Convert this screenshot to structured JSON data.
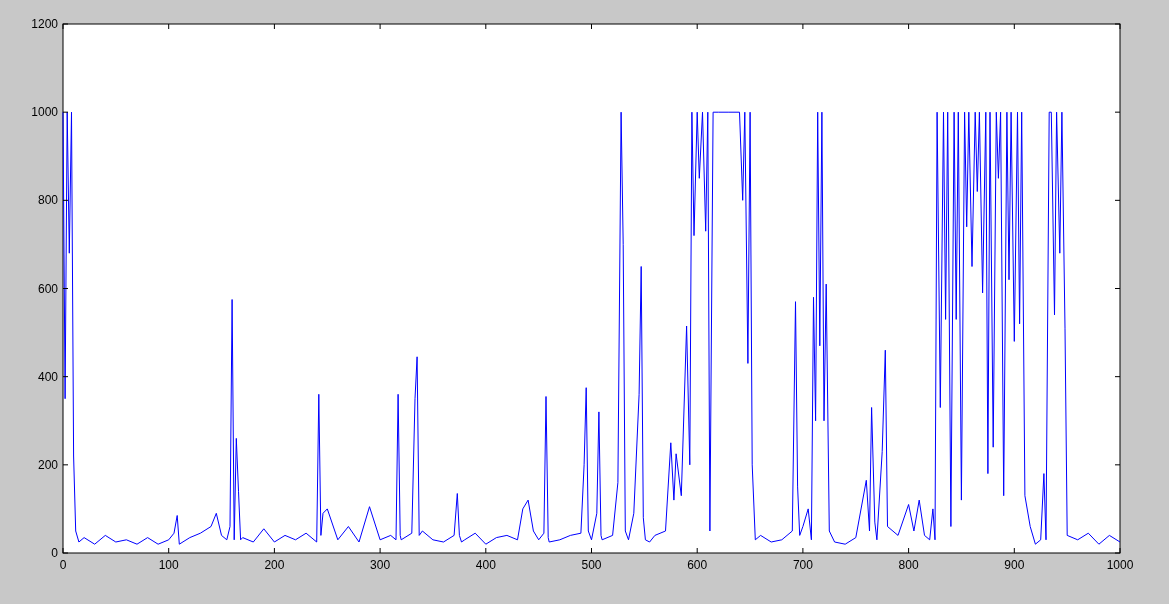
{
  "figure": {
    "chart_data": {
      "type": "line",
      "x": [
        0,
        2,
        4,
        6,
        8,
        10,
        12,
        15,
        20,
        30,
        40,
        50,
        60,
        70,
        80,
        90,
        100,
        105,
        108,
        110,
        120,
        130,
        140,
        145,
        150,
        155,
        158,
        160,
        162,
        164,
        166,
        168,
        170,
        180,
        190,
        200,
        210,
        220,
        230,
        240,
        242,
        244,
        246,
        250,
        260,
        270,
        280,
        290,
        300,
        310,
        315,
        317,
        319,
        320,
        330,
        333,
        335,
        337,
        340,
        350,
        360,
        370,
        373,
        375,
        377,
        380,
        390,
        400,
        410,
        420,
        430,
        435,
        440,
        445,
        450,
        455,
        457,
        459,
        460,
        470,
        480,
        490,
        493,
        495,
        497,
        500,
        505,
        507,
        509,
        510,
        520,
        525,
        528,
        530,
        532,
        535,
        540,
        545,
        547,
        549,
        551,
        555,
        560,
        570,
        575,
        578,
        580,
        585,
        590,
        593,
        595,
        597,
        600,
        602,
        605,
        608,
        610,
        612,
        615,
        620,
        630,
        640,
        643,
        645,
        648,
        650,
        652,
        655,
        660,
        670,
        680,
        690,
        693,
        695,
        697,
        700,
        705,
        708,
        710,
        712,
        714,
        716,
        718,
        720,
        722,
        725,
        730,
        740,
        750,
        760,
        763,
        765,
        768,
        770,
        775,
        778,
        780,
        790,
        800,
        805,
        810,
        815,
        820,
        823,
        825,
        827,
        830,
        833,
        835,
        837,
        840,
        843,
        845,
        847,
        850,
        853,
        855,
        857,
        860,
        863,
        865,
        867,
        870,
        873,
        875,
        877,
        880,
        883,
        885,
        887,
        890,
        893,
        895,
        897,
        900,
        903,
        905,
        907,
        910,
        915,
        920,
        925,
        928,
        930,
        933,
        935,
        938,
        940,
        943,
        945,
        948,
        950,
        960,
        970,
        980,
        990,
        1000
      ],
      "series": [
        {
          "color": "#0000ff",
          "values": [
            1000,
            350,
            1000,
            680,
            1000,
            220,
            50,
            25,
            35,
            20,
            40,
            25,
            30,
            20,
            35,
            20,
            30,
            45,
            85,
            20,
            35,
            45,
            60,
            90,
            40,
            30,
            60,
            575,
            30,
            260,
            140,
            30,
            35,
            25,
            55,
            25,
            40,
            30,
            45,
            25,
            360,
            40,
            90,
            100,
            30,
            60,
            25,
            105,
            30,
            40,
            30,
            360,
            40,
            30,
            45,
            350,
            445,
            40,
            50,
            30,
            25,
            40,
            135,
            40,
            25,
            30,
            45,
            20,
            35,
            40,
            30,
            100,
            120,
            50,
            30,
            45,
            355,
            35,
            25,
            30,
            40,
            45,
            200,
            375,
            50,
            30,
            90,
            320,
            40,
            30,
            40,
            160,
            1000,
            700,
            50,
            30,
            90,
            360,
            650,
            80,
            30,
            25,
            40,
            50,
            250,
            120,
            225,
            130,
            515,
            200,
            1000,
            720,
            1000,
            850,
            1000,
            730,
            1000,
            50,
            1000,
            1000,
            1000,
            1000,
            800,
            1000,
            430,
            1000,
            200,
            30,
            40,
            25,
            30,
            50,
            570,
            150,
            40,
            60,
            100,
            30,
            580,
            300,
            1000,
            470,
            1000,
            300,
            610,
            50,
            25,
            20,
            35,
            165,
            50,
            330,
            70,
            30,
            230,
            460,
            60,
            40,
            110,
            50,
            120,
            40,
            30,
            100,
            30,
            1000,
            330,
            1000,
            530,
            1000,
            60,
            1000,
            530,
            1000,
            120,
            1000,
            740,
            1000,
            650,
            1000,
            820,
            1000,
            590,
            1000,
            180,
            1000,
            240,
            1000,
            850,
            1000,
            130,
            1000,
            620,
            1000,
            480,
            1000,
            520,
            1000,
            130,
            60,
            20,
            30,
            180,
            30,
            1000,
            1000,
            540,
            1000,
            680,
            1000,
            510,
            40,
            30,
            45,
            20,
            40,
            25
          ]
        }
      ],
      "xlim": [
        0,
        1000
      ],
      "ylim": [
        0,
        1200
      ],
      "xticks": [
        0,
        100,
        200,
        300,
        400,
        500,
        600,
        700,
        800,
        900,
        1000
      ],
      "yticks": [
        0,
        200,
        400,
        600,
        800,
        1000,
        1200
      ]
    }
  }
}
